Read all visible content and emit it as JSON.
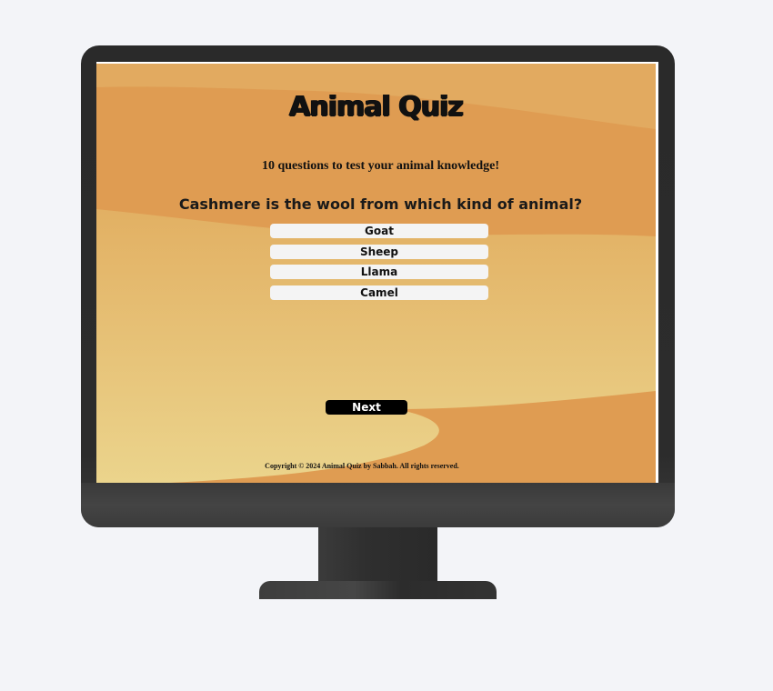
{
  "page": {
    "title": "Animal Quiz",
    "subtitle": "10 questions to test your animal knowledge!",
    "question": "Cashmere is the wool from which kind of animal?",
    "answers": [
      {
        "label": "Goat"
      },
      {
        "label": "Sheep"
      },
      {
        "label": "Llama"
      },
      {
        "label": "Camel"
      }
    ],
    "next_label": "Next",
    "footer": "Copyright © 2024 Animal Quiz by Sabbah. All rights reserved."
  },
  "colors": {
    "background_page": "#f3f4f8",
    "desert_dark": "#df9c52",
    "desert_light": "#ead38c",
    "monitor": "#2c2c2c",
    "button_bg": "#f4f4f4",
    "next_bg": "#000000"
  }
}
